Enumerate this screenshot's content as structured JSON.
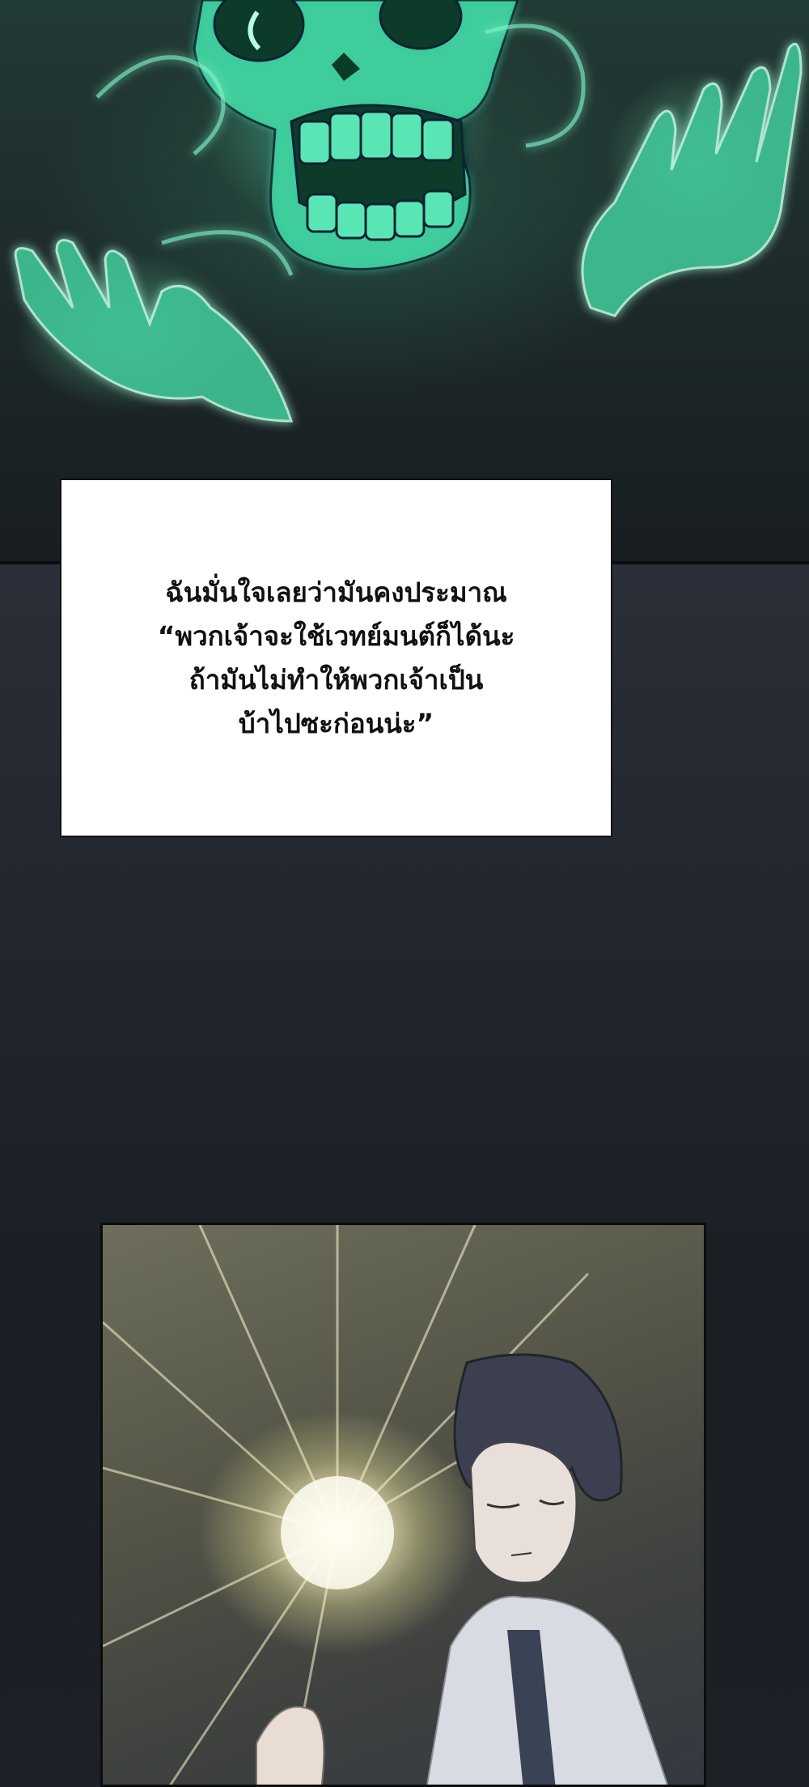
{
  "caption": {
    "lines": [
      "ฉันมั่นใจเลยว่ามันคงประมาณ",
      "“พวกเจ้าจะใช้เวทย์มนต์ก็ได้นะ",
      "ถ้ามันไม่ทำให้พวกเจ้าเป็น",
      "บ้าไปซะก่อนน่ะ”"
    ]
  },
  "colors": {
    "spectral_green": "#5fe0b0",
    "night_bg": "#1c1f26",
    "caption_bg": "#ffffff",
    "glow": "#fffbe0"
  },
  "icons": {
    "top_panel": "skeleton-spirit-illustration",
    "bottom_panel": "character-light-burst-illustration"
  }
}
